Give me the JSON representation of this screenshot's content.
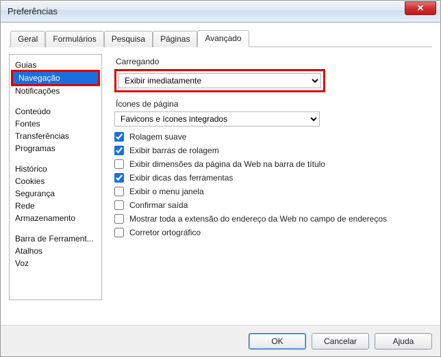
{
  "window": {
    "title": "Preferências"
  },
  "tabs": [
    {
      "label": "Geral"
    },
    {
      "label": "Formulários"
    },
    {
      "label": "Pesquisa"
    },
    {
      "label": "Páginas"
    },
    {
      "label": "Avançado",
      "active": true
    }
  ],
  "nav": {
    "group1": [
      {
        "label": "Guias"
      },
      {
        "label": "Navegação",
        "selected": true
      },
      {
        "label": "Notificações"
      }
    ],
    "group2": [
      {
        "label": "Conteúdo"
      },
      {
        "label": "Fontes"
      },
      {
        "label": "Transferências"
      },
      {
        "label": "Programas"
      }
    ],
    "group3": [
      {
        "label": "Histórico"
      },
      {
        "label": "Cookies"
      },
      {
        "label": "Segurança"
      },
      {
        "label": "Rede"
      },
      {
        "label": "Armazenamento"
      }
    ],
    "group4": [
      {
        "label": "Barra de Ferrament..."
      },
      {
        "label": "Atalhos"
      },
      {
        "label": "Voz"
      }
    ]
  },
  "settings": {
    "loading_label": "Carregando",
    "loading_value": "Exibir imediatamente",
    "page_icons_label": "Ícones de página",
    "page_icons_value": "Favicons e ícones integrados",
    "checks": [
      {
        "label": "Rolagem suave",
        "checked": true
      },
      {
        "label": "Exibir barras de rolagem",
        "checked": true
      },
      {
        "label": "Exibir dimensões da página da Web na barra de título",
        "checked": false
      },
      {
        "label": "Exibir dicas das ferramentas",
        "checked": true
      },
      {
        "label": "Exibir o menu janela",
        "checked": false
      },
      {
        "label": "Confirmar saída",
        "checked": false
      },
      {
        "label": "Mostrar toda a extensão do endereço da Web no campo de endereços",
        "checked": false
      },
      {
        "label": "Corretor ortográfico",
        "checked": false
      }
    ]
  },
  "buttons": {
    "ok": "OK",
    "cancel": "Cancelar",
    "help": "Ajuda"
  }
}
